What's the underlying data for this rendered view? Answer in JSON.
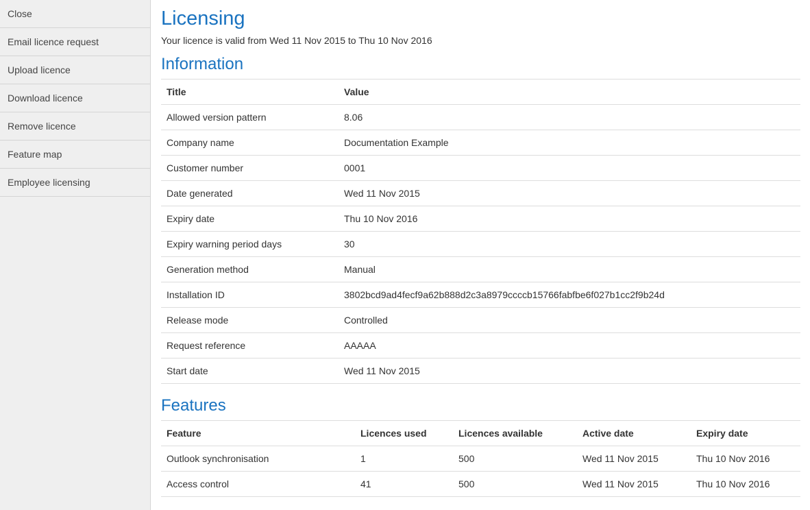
{
  "sidebar": {
    "items": [
      {
        "label": "Close"
      },
      {
        "label": "Email licence request"
      },
      {
        "label": "Upload licence"
      },
      {
        "label": "Download licence"
      },
      {
        "label": "Remove licence"
      },
      {
        "label": "Feature map"
      },
      {
        "label": "Employee licensing"
      }
    ]
  },
  "main": {
    "title": "Licensing",
    "validity": "Your licence is valid from Wed 11 Nov 2015 to Thu 10 Nov 2016",
    "information": {
      "heading": "Information",
      "columns": [
        "Title",
        "Value"
      ],
      "rows": [
        [
          "Allowed version pattern",
          "8.06"
        ],
        [
          "Company name",
          "Documentation Example"
        ],
        [
          "Customer number",
          "0001"
        ],
        [
          "Date generated",
          "Wed 11 Nov 2015"
        ],
        [
          "Expiry date",
          "Thu 10 Nov 2016"
        ],
        [
          "Expiry warning period days",
          "30"
        ],
        [
          "Generation method",
          "Manual"
        ],
        [
          "Installation ID",
          "3802bcd9ad4fecf9a62b888d2c3a8979ccccb15766fabfbe6f027b1cc2f9b24d"
        ],
        [
          "Release mode",
          "Controlled"
        ],
        [
          "Request reference",
          "AAAAA"
        ],
        [
          "Start date",
          "Wed 11 Nov 2015"
        ]
      ]
    },
    "features": {
      "heading": "Features",
      "columns": [
        "Feature",
        "Licences used",
        "Licences available",
        "Active date",
        "Expiry date"
      ],
      "rows": [
        [
          "Outlook synchronisation",
          "1",
          "500",
          "Wed 11 Nov 2015",
          "Thu 10 Nov 2016"
        ],
        [
          "Access control",
          "41",
          "500",
          "Wed 11 Nov 2015",
          "Thu 10 Nov 2016"
        ]
      ]
    }
  }
}
